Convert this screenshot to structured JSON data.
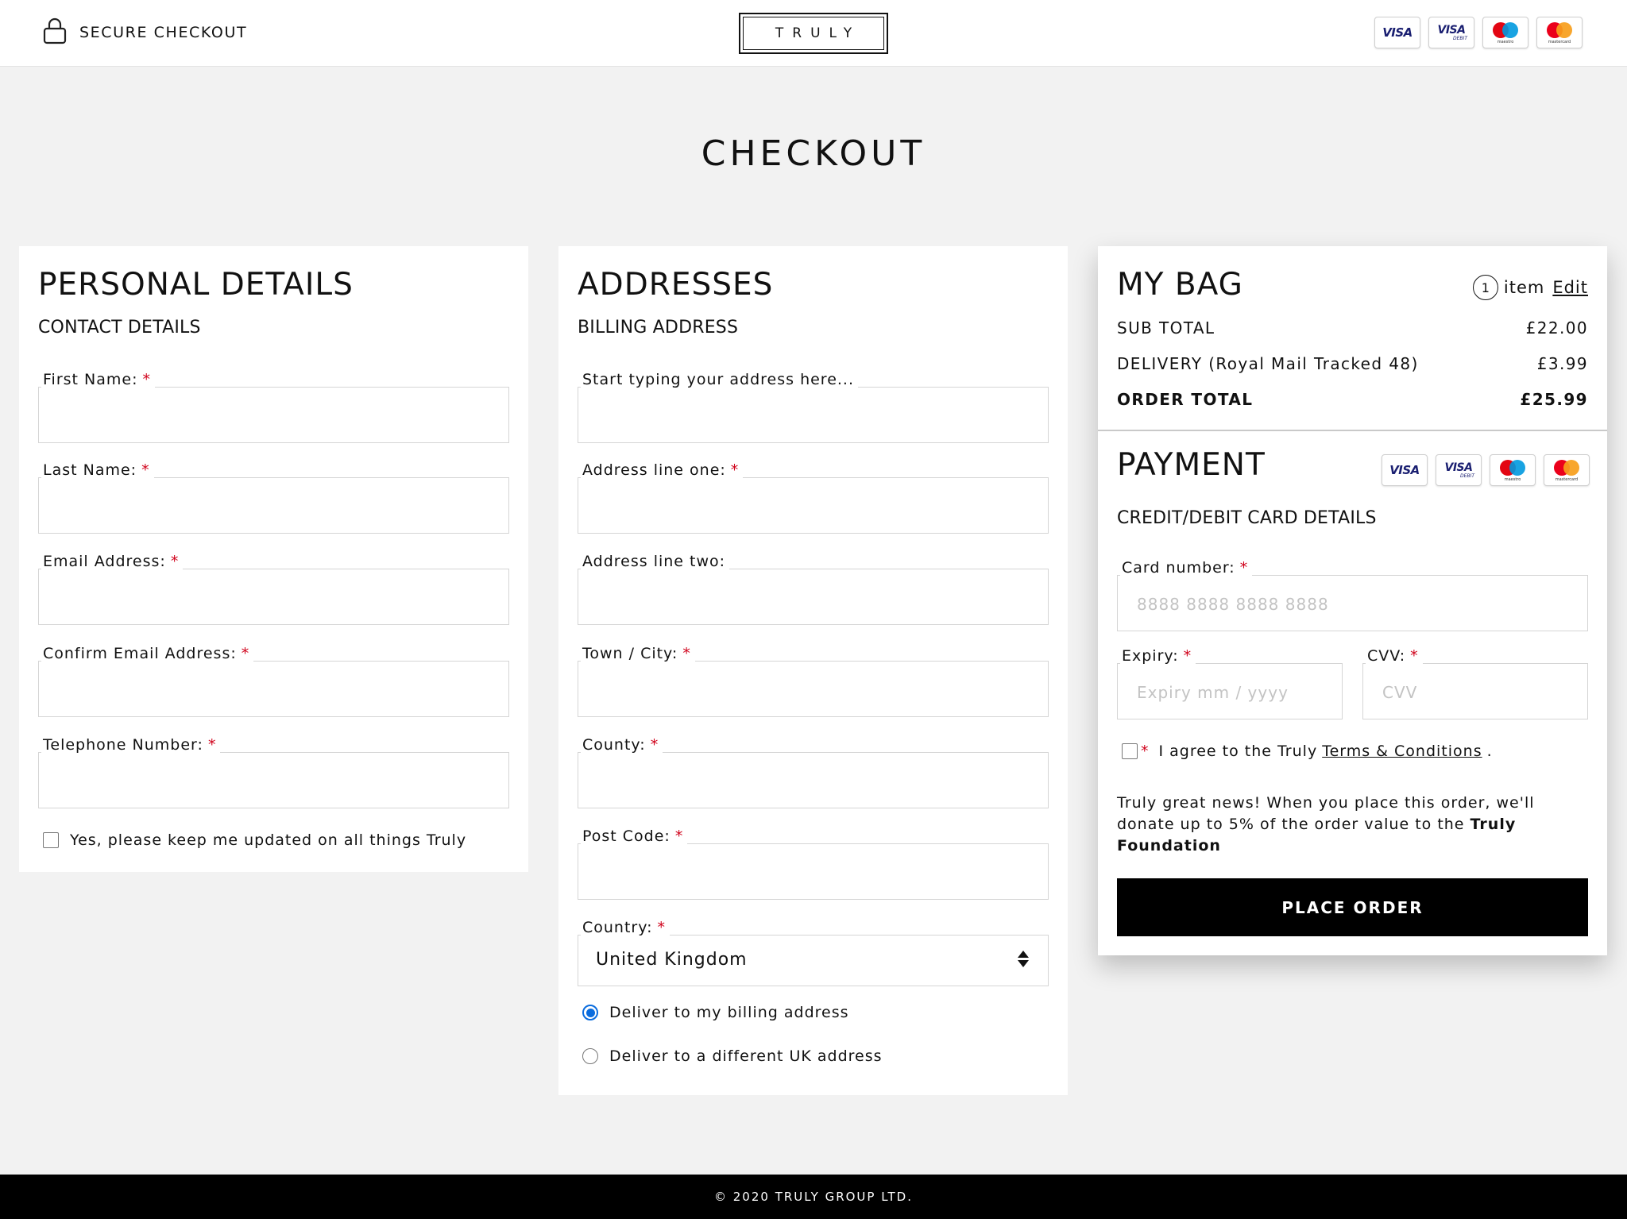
{
  "header": {
    "secure_label": "SECURE CHECKOUT",
    "logo": "TRULY",
    "card_icons": [
      "visa-icon",
      "visa-debit-icon",
      "maestro-icon",
      "mastercard-icon"
    ]
  },
  "cards": {
    "visa": "VISA",
    "debit": "DEBIT",
    "maestro": "maestro",
    "mastercard": "mastercard"
  },
  "page_title": "CHECKOUT",
  "personal": {
    "title": "PERSONAL DETAILS",
    "subtitle": "CONTACT DETAILS",
    "fields": [
      {
        "label": "First Name:",
        "required": "*"
      },
      {
        "label": "Last Name:",
        "required": "*"
      },
      {
        "label": "Email Address:",
        "required": "*"
      },
      {
        "label": "Confirm Email Address:",
        "required": "*"
      },
      {
        "label": "Telephone Number:",
        "required": "*"
      }
    ],
    "newsletter_label": "Yes, please keep me updated on all things Truly"
  },
  "addresses": {
    "title": "ADDRESSES",
    "subtitle": "BILLING ADDRESS",
    "lookup_label": "Start typing your address here...",
    "fields": [
      {
        "label": "Address line one:",
        "required": "*"
      },
      {
        "label": "Address line two:",
        "required": ""
      },
      {
        "label": "Town / City:",
        "required": "*"
      },
      {
        "label": "County:",
        "required": "*"
      },
      {
        "label": "Post Code:",
        "required": "*"
      }
    ],
    "country": {
      "label": "Country:",
      "required": "*",
      "value": "United Kingdom"
    },
    "delivery_options": [
      {
        "label": "Deliver to my billing address",
        "selected": true
      },
      {
        "label": "Deliver to a different UK address",
        "selected": false
      }
    ]
  },
  "bag": {
    "title": "MY BAG",
    "count": "1",
    "item_label": "item",
    "edit_label": "Edit",
    "rows": [
      {
        "label": "SUB TOTAL",
        "value": "£22.00"
      },
      {
        "label": "DELIVERY (Royal Mail Tracked 48)",
        "value": "£3.99"
      },
      {
        "label": "ORDER TOTAL",
        "value": "£25.99"
      }
    ]
  },
  "payment": {
    "title": "PAYMENT",
    "subtitle": "CREDIT/DEBIT CARD DETAILS",
    "card_number": {
      "label": "Card number:",
      "required": "*",
      "placeholder": "8888 8888 8888 8888"
    },
    "expiry": {
      "label": "Expiry:",
      "required": "*",
      "placeholder": "Expiry mm / yyyy"
    },
    "cvv": {
      "label": "CVV:",
      "required": "*",
      "placeholder": "CVV"
    },
    "agree_required": "*",
    "agree_prefix": "I agree to the Truly",
    "terms_label": "Terms & Conditions",
    "agree_suffix": ".",
    "news_text": "Truly great news! When you place this order, we'll donate up to 5% of the order value to the",
    "news_bold": "Truly Foundation",
    "place_order_label": "PLACE ORDER"
  },
  "footer": {
    "copyright": "© 2020 TRULY GROUP LTD."
  },
  "colors": {
    "required": "#d0021b",
    "radio_selected": "#0a6cde",
    "button_bg": "#000000"
  }
}
